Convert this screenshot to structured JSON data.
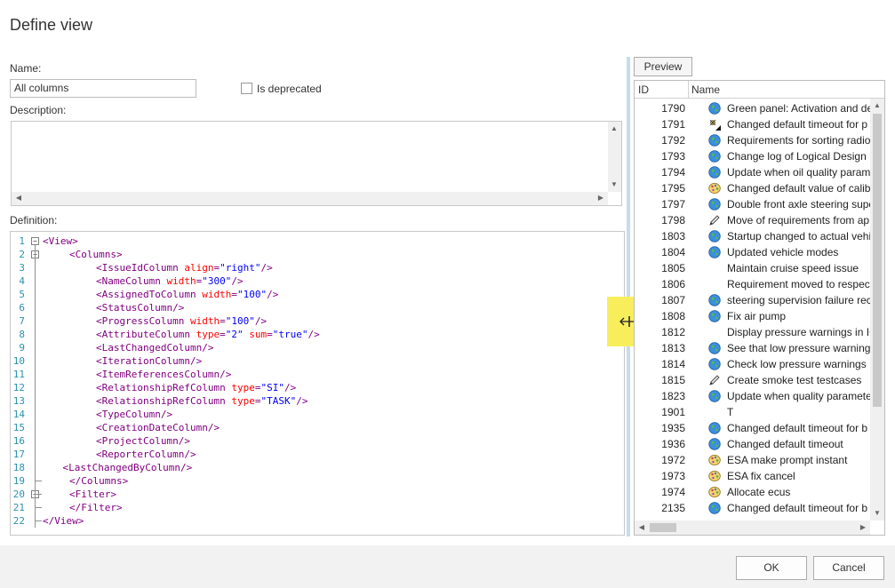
{
  "dialog": {
    "title": "Define view"
  },
  "form": {
    "name_label": "Name:",
    "name_value": "All columns",
    "deprecated_label": "Is deprecated",
    "description_label": "Description:",
    "description_value": "",
    "definition_label": "Definition:"
  },
  "definition_lines": [
    {
      "n": "1",
      "indent": 0,
      "parts": [
        [
          "b",
          "<"
        ],
        [
          "t",
          "View"
        ],
        [
          "b",
          ">"
        ]
      ]
    },
    {
      "n": "2",
      "indent": 4,
      "parts": [
        [
          "b",
          "<"
        ],
        [
          "t",
          "Columns"
        ],
        [
          "b",
          ">"
        ]
      ]
    },
    {
      "n": "3",
      "indent": 8,
      "parts": [
        [
          "b",
          "<"
        ],
        [
          "t",
          "IssueIdColumn"
        ],
        [
          "b",
          " "
        ],
        [
          "a",
          "align"
        ],
        [
          "b",
          "="
        ],
        [
          "v",
          "\"right\""
        ],
        [
          "b",
          "/>"
        ]
      ]
    },
    {
      "n": "4",
      "indent": 8,
      "parts": [
        [
          "b",
          "<"
        ],
        [
          "t",
          "NameColumn"
        ],
        [
          "b",
          " "
        ],
        [
          "a",
          "width"
        ],
        [
          "b",
          "="
        ],
        [
          "v",
          "\"300\""
        ],
        [
          "b",
          "/>"
        ]
      ]
    },
    {
      "n": "5",
      "indent": 8,
      "parts": [
        [
          "b",
          "<"
        ],
        [
          "t",
          "AssignedToColumn"
        ],
        [
          "b",
          " "
        ],
        [
          "a",
          "width"
        ],
        [
          "b",
          "="
        ],
        [
          "v",
          "\"100\""
        ],
        [
          "b",
          "/>"
        ]
      ]
    },
    {
      "n": "6",
      "indent": 8,
      "parts": [
        [
          "b",
          "<"
        ],
        [
          "t",
          "StatusColumn"
        ],
        [
          "b",
          "/>"
        ]
      ]
    },
    {
      "n": "7",
      "indent": 8,
      "parts": [
        [
          "b",
          "<"
        ],
        [
          "t",
          "ProgressColumn"
        ],
        [
          "b",
          " "
        ],
        [
          "a",
          "width"
        ],
        [
          "b",
          "="
        ],
        [
          "v",
          "\"100\""
        ],
        [
          "b",
          "/>"
        ]
      ]
    },
    {
      "n": "8",
      "indent": 8,
      "parts": [
        [
          "b",
          "<"
        ],
        [
          "t",
          "AttributeColumn"
        ],
        [
          "b",
          " "
        ],
        [
          "a",
          "type"
        ],
        [
          "b",
          "="
        ],
        [
          "v",
          "\"2\""
        ],
        [
          "b",
          " "
        ],
        [
          "a",
          "sum"
        ],
        [
          "b",
          "="
        ],
        [
          "v",
          "\"true\""
        ],
        [
          "b",
          "/>"
        ]
      ]
    },
    {
      "n": "9",
      "indent": 8,
      "parts": [
        [
          "b",
          "<"
        ],
        [
          "t",
          "LastChangedColumn"
        ],
        [
          "b",
          "/>"
        ]
      ]
    },
    {
      "n": "10",
      "indent": 8,
      "parts": [
        [
          "b",
          "<"
        ],
        [
          "t",
          "IterationColumn"
        ],
        [
          "b",
          "/>"
        ]
      ]
    },
    {
      "n": "11",
      "indent": 8,
      "parts": [
        [
          "b",
          "<"
        ],
        [
          "t",
          "ItemReferencesColumn"
        ],
        [
          "b",
          "/>"
        ]
      ]
    },
    {
      "n": "12",
      "indent": 8,
      "parts": [
        [
          "b",
          "<"
        ],
        [
          "t",
          "RelationshipRefColumn"
        ],
        [
          "b",
          " "
        ],
        [
          "a",
          "type"
        ],
        [
          "b",
          "="
        ],
        [
          "v",
          "\"SI\""
        ],
        [
          "b",
          "/>"
        ]
      ]
    },
    {
      "n": "13",
      "indent": 8,
      "parts": [
        [
          "b",
          "<"
        ],
        [
          "t",
          "RelationshipRefColumn"
        ],
        [
          "b",
          " "
        ],
        [
          "a",
          "type"
        ],
        [
          "b",
          "="
        ],
        [
          "v",
          "\"TASK\""
        ],
        [
          "b",
          "/>"
        ]
      ]
    },
    {
      "n": "14",
      "indent": 8,
      "parts": [
        [
          "b",
          "<"
        ],
        [
          "t",
          "TypeColumn"
        ],
        [
          "b",
          "/>"
        ]
      ]
    },
    {
      "n": "15",
      "indent": 8,
      "parts": [
        [
          "b",
          "<"
        ],
        [
          "t",
          "CreationDateColumn"
        ],
        [
          "b",
          "/>"
        ]
      ]
    },
    {
      "n": "16",
      "indent": 8,
      "parts": [
        [
          "b",
          "<"
        ],
        [
          "t",
          "ProjectColumn"
        ],
        [
          "b",
          "/>"
        ]
      ]
    },
    {
      "n": "17",
      "indent": 8,
      "parts": [
        [
          "b",
          "<"
        ],
        [
          "t",
          "ReporterColumn"
        ],
        [
          "b",
          "/>"
        ]
      ]
    },
    {
      "n": "18",
      "indent": 3,
      "parts": [
        [
          "b",
          "<"
        ],
        [
          "t",
          "LastChangedByColumn"
        ],
        [
          "b",
          "/>"
        ]
      ]
    },
    {
      "n": "19",
      "indent": 4,
      "parts": [
        [
          "b",
          "</"
        ],
        [
          "t",
          "Columns"
        ],
        [
          "b",
          ">"
        ]
      ]
    },
    {
      "n": "20",
      "indent": 4,
      "parts": [
        [
          "b",
          "<"
        ],
        [
          "t",
          "Filter"
        ],
        [
          "b",
          ">"
        ]
      ]
    },
    {
      "n": "21",
      "indent": 4,
      "parts": [
        [
          "b",
          "</"
        ],
        [
          "t",
          "Filter"
        ],
        [
          "b",
          ">"
        ]
      ]
    },
    {
      "n": "22",
      "indent": 0,
      "parts": [
        [
          "b",
          "</"
        ],
        [
          "t",
          "View"
        ],
        [
          "b",
          ">"
        ]
      ]
    }
  ],
  "preview": {
    "button_label": "Preview",
    "col_id": "ID",
    "col_name": "Name",
    "rows": [
      {
        "id": "1790",
        "icon": "globe-icon",
        "name": "Green panel: Activation and de"
      },
      {
        "id": "1791",
        "icon": "bug-icon",
        "name": "Changed default timeout for p"
      },
      {
        "id": "1792",
        "icon": "globe-icon",
        "name": "Requirements for sorting radio"
      },
      {
        "id": "1793",
        "icon": "globe-icon",
        "name": "Change log of Logical Design"
      },
      {
        "id": "1794",
        "icon": "globe-icon",
        "name": "Update when oil quality param"
      },
      {
        "id": "1795",
        "icon": "palette-icon",
        "name": "Changed default value of calib"
      },
      {
        "id": "1797",
        "icon": "globe-icon",
        "name": "Double front axle steering supe"
      },
      {
        "id": "1798",
        "icon": "pencil-icon",
        "name": "Move of requirements from ap"
      },
      {
        "id": "1803",
        "icon": "globe-icon",
        "name": "Startup changed to actual vehi"
      },
      {
        "id": "1804",
        "icon": "globe-icon",
        "name": "Updated vehicle modes"
      },
      {
        "id": "1805",
        "icon": "",
        "name": "Maintain cruise speed issue"
      },
      {
        "id": "1806",
        "icon": "",
        "name": "Requirement moved to respec"
      },
      {
        "id": "1807",
        "icon": "globe-icon",
        "name": "steering supervision failure rec"
      },
      {
        "id": "1808",
        "icon": "globe-icon",
        "name": "Fix air pump"
      },
      {
        "id": "1812",
        "icon": "",
        "name": "Display pressure warnings in IC"
      },
      {
        "id": "1813",
        "icon": "globe-icon",
        "name": "See that low pressure warning"
      },
      {
        "id": "1814",
        "icon": "globe-icon",
        "name": "Check low pressure warnings"
      },
      {
        "id": "1815",
        "icon": "pencil-icon",
        "name": "Create smoke test testcases"
      },
      {
        "id": "1823",
        "icon": "globe-icon",
        "name": "Update when quality paramete"
      },
      {
        "id": "1901",
        "icon": "",
        "name": "T"
      },
      {
        "id": "1935",
        "icon": "globe-icon",
        "name": "Changed default timeout for b"
      },
      {
        "id": "1936",
        "icon": "globe-icon",
        "name": "Changed default timeout"
      },
      {
        "id": "1972",
        "icon": "palette-icon",
        "name": "ESA make prompt instant"
      },
      {
        "id": "1973",
        "icon": "palette-icon",
        "name": "ESA fix cancel"
      },
      {
        "id": "1974",
        "icon": "palette-icon",
        "name": "Allocate ecus"
      },
      {
        "id": "2135",
        "icon": "globe-icon",
        "name": "Changed default timeout for b"
      }
    ]
  },
  "buttons": {
    "ok": "OK",
    "cancel": "Cancel"
  },
  "colors": {
    "accent": "#c5dcef",
    "highlight": "#f8ee5c",
    "footer": "#f2f2f2"
  }
}
